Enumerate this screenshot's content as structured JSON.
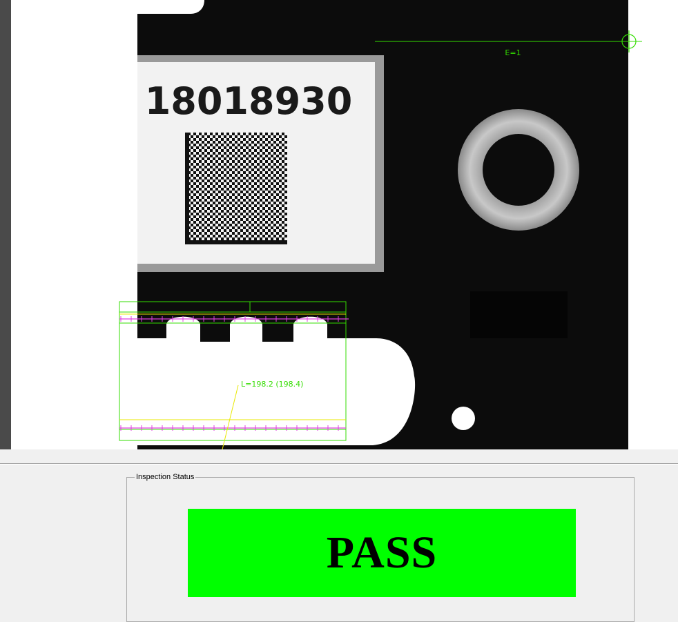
{
  "viewport": {
    "part_serial": "18018930",
    "edge_annotation": "E=1",
    "length_annotation": "L=198.2 (198.4)",
    "colors": {
      "overlay_green": "#33dd00",
      "overlay_magenta": "#e040e0",
      "overlay_yellow": "#e8e800",
      "part_black": "#0c0c0c",
      "label_white": "#f2f2f2"
    },
    "icons": [
      "crosshair-icon"
    ]
  },
  "status_panel": {
    "group_title": "Inspection Status",
    "result": "PASS",
    "result_color": "#00ff00"
  }
}
